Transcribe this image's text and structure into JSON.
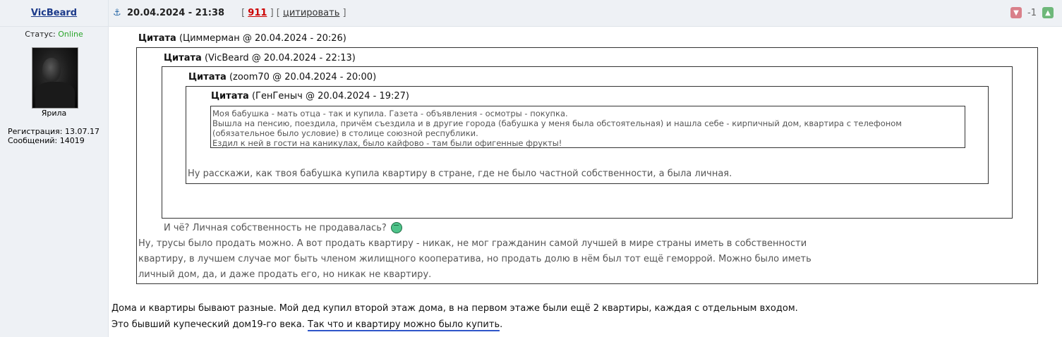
{
  "author": {
    "username": "VicBeard",
    "status_label": "Статус:",
    "status_value": "Online",
    "rank": "Ярила",
    "registration": "Регистрация: 13.07.17",
    "messages": "Сообщений: 14019"
  },
  "post": {
    "date": "20.04.2024 - 21:38",
    "number": "911",
    "quote_link": "цитировать",
    "rating_value": "-1"
  },
  "quote_label": "Цитата",
  "quotes": {
    "q1": {
      "source": "(Циммерман @ 20.04.2024 - 20:26)",
      "text": "Ну, трусы было продать можно. А вот продать квартиру - никак, не мог гражданин самой лучшей в мире страны иметь в собственности квартиру, в лучшем случае мог быть членом жилищного кооператива, но продать долю в нём был тот ещё геморрой. Можно было иметь личный дом, да, и даже продать его, но никак не квартиру."
    },
    "q2": {
      "source": "(VicBeard @ 20.04.2024 - 22:13)",
      "text": "И чё? Личная собственность не продавалась?"
    },
    "q3": {
      "source": "(zoom70 @ 20.04.2024 - 20:00)",
      "text": "Ну расскажи, как твоя бабушка купила квартиру в стране, где не было частной собственности, а была личная."
    },
    "q4": {
      "source": "(ГенГеныч @ 20.04.2024 - 19:27)",
      "lines": [
        "Моя бабушка - мать отца - так и купила. Газета - объявления - осмотры - покупка.",
        "Вышла на пенсию, поездила, причём съездила и в другие города (бабушка у меня была обстоятельная) и нашла себе - кирпичный дом, квартира с телефоном",
        "(обязательное было условие) в столице союзной республики.",
        "Ездил к ней в гости на каникулах, было кайфово - там были офигенные фрукты!"
      ]
    }
  },
  "body": {
    "text": "Дома и квартиры бывают разные. Мой дед купил второй этаж дома, в на первом этаже были ещё 2 квартиры, каждая с отдельным входом. Это бывший купеческий дом19-го века. ",
    "link": "Так что и квартиру можно было купить",
    "end": "."
  },
  "icons": [
    "anchor-icon",
    "thumbs-down-icon",
    "thumbs-up-icon",
    "smile-icon"
  ]
}
